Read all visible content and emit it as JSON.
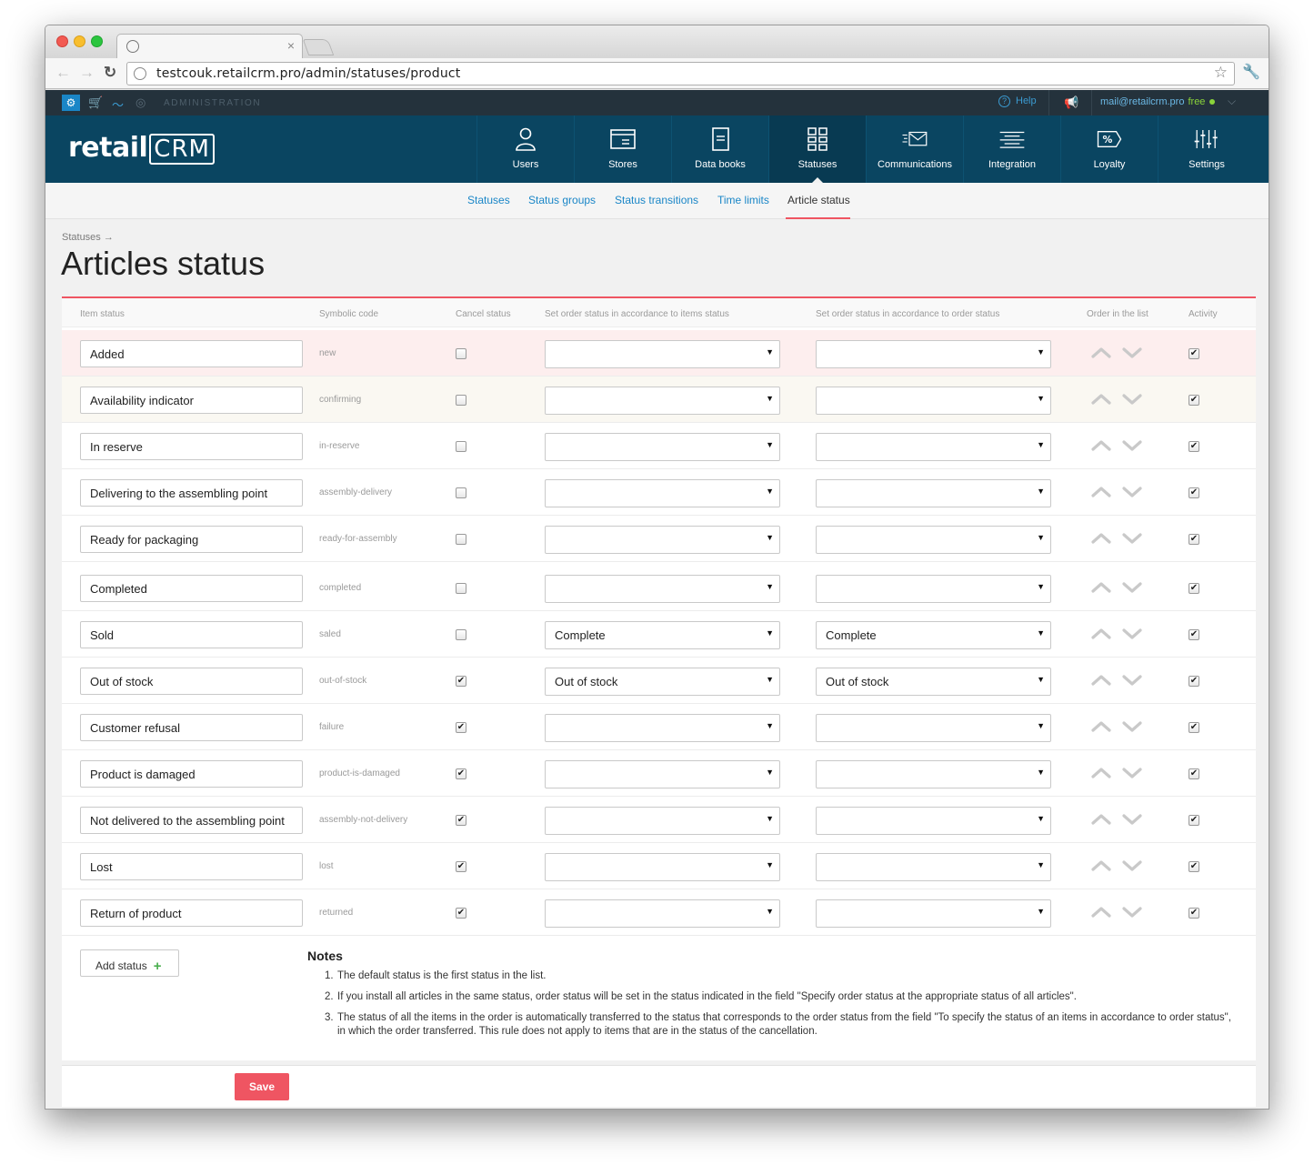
{
  "browser": {
    "url": "testcouk.retailcrm.pro/admin/statuses/product"
  },
  "adminbar": {
    "section": "ADMINISTRATION",
    "help": "Help",
    "user_email": "mail@retailcrm.pro",
    "plan": "free"
  },
  "logo": {
    "text": "retail",
    "crm": "CRM"
  },
  "nav": [
    {
      "label": "Users",
      "icon": "user-icon"
    },
    {
      "label": "Stores",
      "icon": "store-icon"
    },
    {
      "label": "Data books",
      "icon": "book-icon"
    },
    {
      "label": "Statuses",
      "icon": "statuses-icon",
      "active": true
    },
    {
      "label": "Communications",
      "icon": "envelope-icon"
    },
    {
      "label": "Integration",
      "icon": "integration-icon"
    },
    {
      "label": "Loyalty",
      "icon": "percent-tag-icon"
    },
    {
      "label": "Settings",
      "icon": "sliders-icon"
    }
  ],
  "subnav": [
    {
      "label": "Statuses"
    },
    {
      "label": "Status groups"
    },
    {
      "label": "Status transitions"
    },
    {
      "label": "Time limits"
    },
    {
      "label": "Article status",
      "active": true
    }
  ],
  "page": {
    "breadcrumb": "Statuses →",
    "title": "Articles status"
  },
  "table": {
    "headers": {
      "item_status": "Item status",
      "symbolic_code": "Symbolic code",
      "cancel_status": "Cancel status",
      "set_by_items": "Set order status in accordance to items status",
      "set_by_order": "Set order status in accordance to order status",
      "order_in_list": "Order in the list",
      "activity": "Activity"
    },
    "rows": [
      {
        "name": "Added",
        "code": "new",
        "cancel": false,
        "by_items": "",
        "by_order": "",
        "active": true
      },
      {
        "name": "Availability indicator",
        "code": "confirming",
        "cancel": false,
        "by_items": "",
        "by_order": "",
        "active": true
      },
      {
        "name": "In reserve",
        "code": "in-reserve",
        "cancel": false,
        "by_items": "",
        "by_order": "",
        "active": true
      },
      {
        "name": "Delivering to the assembling point",
        "code": "assembly-delivery",
        "cancel": false,
        "by_items": "",
        "by_order": "",
        "active": true
      },
      {
        "name": "Ready for packaging",
        "code": "ready-for-assembly",
        "cancel": false,
        "by_items": "",
        "by_order": "",
        "active": true
      },
      {
        "name": "Completed",
        "code": "completed",
        "cancel": false,
        "by_items": "",
        "by_order": "",
        "active": true
      },
      {
        "name": "Sold",
        "code": "saled",
        "cancel": false,
        "by_items": "Complete",
        "by_order": "Complete",
        "active": true
      },
      {
        "name": "Out of stock",
        "code": "out-of-stock",
        "cancel": true,
        "by_items": "Out of stock",
        "by_order": "Out of stock",
        "active": true
      },
      {
        "name": "Customer refusal",
        "code": "failure",
        "cancel": true,
        "by_items": "",
        "by_order": "",
        "active": true
      },
      {
        "name": "Product is damaged",
        "code": "product-is-damaged",
        "cancel": true,
        "by_items": "",
        "by_order": "",
        "active": true
      },
      {
        "name": "Not delivered to the assembling point",
        "code": "assembly-not-delivery",
        "cancel": true,
        "by_items": "",
        "by_order": "",
        "active": true
      },
      {
        "name": "Lost",
        "code": "lost",
        "cancel": true,
        "by_items": "",
        "by_order": "",
        "active": true
      },
      {
        "name": "Return of product",
        "code": "returned",
        "cancel": true,
        "by_items": "",
        "by_order": "",
        "active": true
      }
    ]
  },
  "add_status_label": "Add status",
  "notes": {
    "title": "Notes",
    "items": [
      "The default status is the first status in the list.",
      "If you install all articles in the same status, order status will be set in the status indicated in the field \"Specify order status at the appropriate status of all articles\".",
      "The status of all the items in the order is automatically transferred to the status that corresponds to the order status from the field \"To specify the status of an items in accordance to order status\", in which the order transferred. This rule does not apply to items that are in the status of the cancellation."
    ]
  },
  "save_label": "Save",
  "colors": {
    "brand": "#0a4561",
    "accent": "#ef5562",
    "link": "#1a86c7",
    "admin_bar": "#24323c"
  }
}
